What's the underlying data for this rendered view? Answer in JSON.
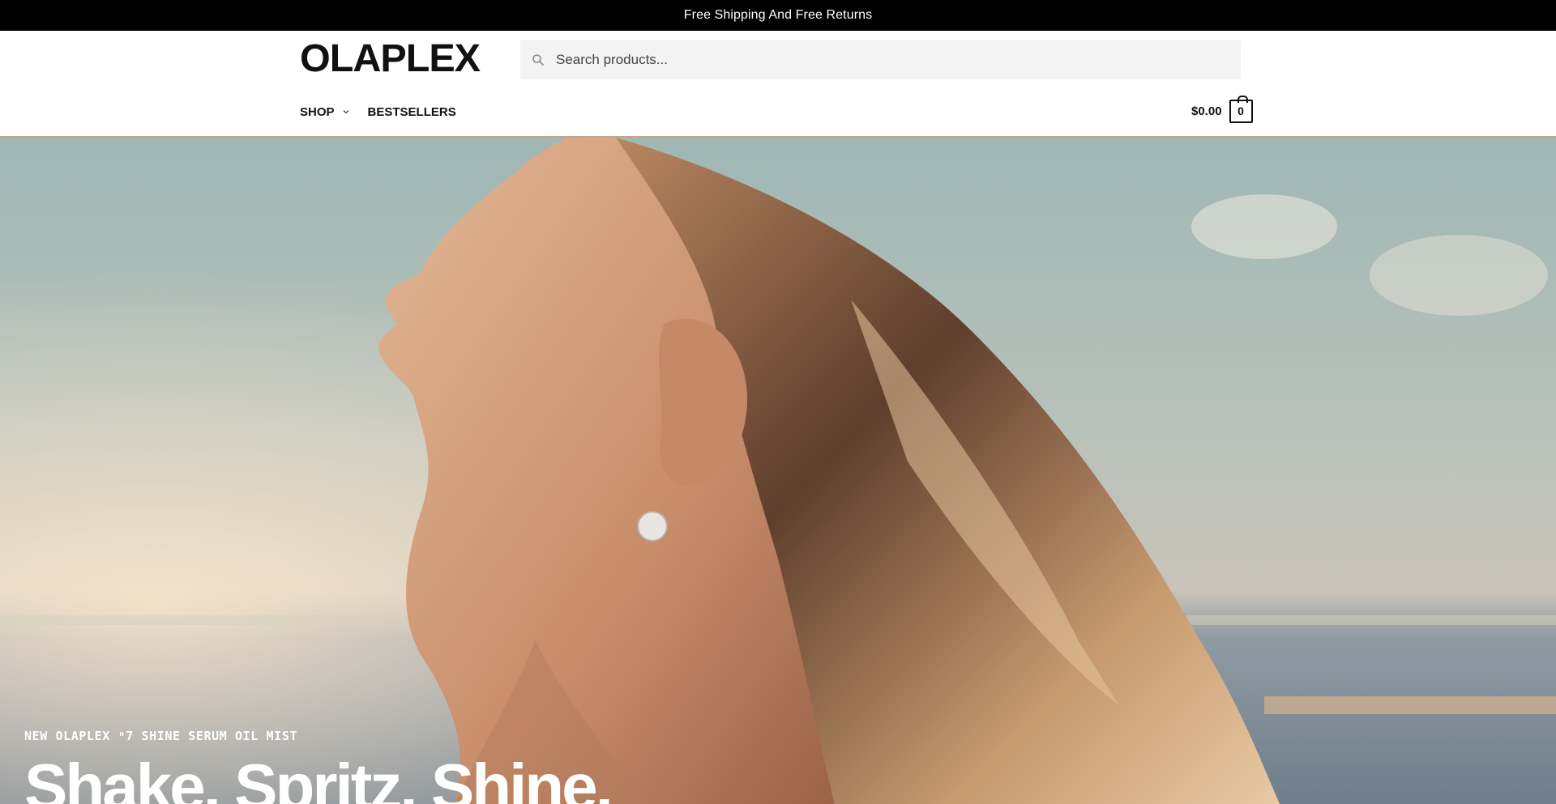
{
  "announcement": {
    "text": "Free Shipping And Free Returns"
  },
  "brand": {
    "name": "OLAPLEX"
  },
  "search": {
    "placeholder": "Search products...",
    "icon": "search-icon"
  },
  "nav": {
    "items": [
      {
        "label": "SHOP",
        "has_dropdown": true
      },
      {
        "label": "BESTSELLERS",
        "has_dropdown": false
      }
    ]
  },
  "cart": {
    "total": "$0.00",
    "count": "0",
    "icon": "cart-bag-icon"
  },
  "hero": {
    "eyebrow": "NEW OLAPLEX ⁿ7 SHINE SERUM OIL MIST",
    "headline": "Shake. Spritz. Shine.",
    "image_alt": "Woman with windswept hair facing the sky by the sea"
  },
  "colors": {
    "announcement_bg": "#000000",
    "accent": "#111111",
    "search_bg": "#f3f3f3"
  }
}
